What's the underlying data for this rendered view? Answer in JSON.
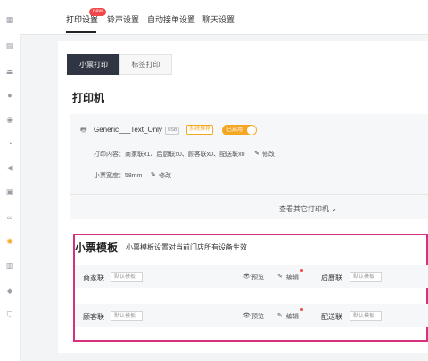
{
  "sidebar": {
    "icons": [
      "dashboard-icon",
      "document-icon",
      "store-icon",
      "user-icon",
      "target-icon",
      "pie-icon",
      "megaphone-icon",
      "gift-icon",
      "bike-icon",
      "settings-icon",
      "book-icon",
      "diamond-icon",
      "shield-icon"
    ],
    "active_index": 9
  },
  "topbar": {
    "tabs": [
      {
        "label": "打印设置",
        "active": true
      },
      {
        "label": "铃声设置",
        "active": false
      },
      {
        "label": "自动接单设置",
        "active": false
      },
      {
        "label": "聊天设置",
        "active": false
      }
    ],
    "badge": "new"
  },
  "subtabs": [
    {
      "label": "小票打印",
      "active": true
    },
    {
      "label": "标签打印",
      "active": false
    }
  ],
  "printer": {
    "section_title": "打印机",
    "name": "Generic___Text_Only",
    "usb_tag": "USB",
    "recommend_tag": "系统推荐",
    "toggle_label": "已启用",
    "content_line": "打印内容：商家联x1、后厨联x0、顾客联x0、配送联x0",
    "modify_label": "修改",
    "width_line": "小票宽度：58mm",
    "more_label": "查看其它打印机"
  },
  "templates": {
    "title": "小票模板",
    "desc": "小票模板设置对当前门店所有设备生效",
    "preview_label": "预览",
    "edit_label": "编辑",
    "rows": [
      {
        "left_label": "商家联",
        "left_select": "默认模板",
        "right_label": "后厨联",
        "right_select": "默认模板"
      },
      {
        "left_label": "顾客联",
        "left_select": "默认模板",
        "right_label": "配送联",
        "right_select": "默认模板"
      }
    ]
  },
  "colors": {
    "accent": "#f5a623",
    "highlight_frame": "#d6317f",
    "dark_tab": "#2f3542",
    "badge": "#f04848"
  }
}
